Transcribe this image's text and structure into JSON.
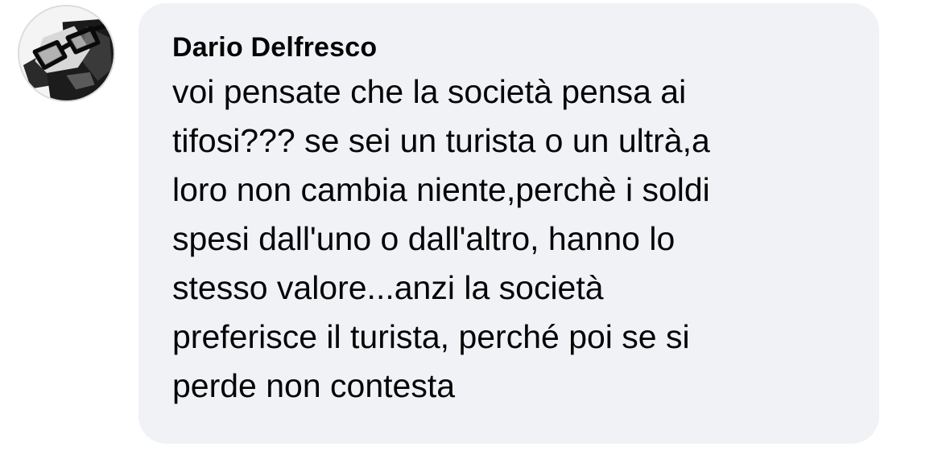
{
  "comment": {
    "avatar_icon": "user-photo-avatar",
    "author": "Dario Delfresco",
    "lines": [
      "voi pensate che la società pensa ai",
      "tifosi??? se sei un turista o un ultrà,a",
      "loro non cambia niente,perchè i soldi",
      "spesi dall'uno o dall'altro, hanno lo",
      "stesso valore...anzi la società",
      "preferisce il turista, perché poi se si",
      "perde non contesta"
    ]
  },
  "colors": {
    "bubble_background": "#f0f2f5",
    "text": "#050505",
    "page_background": "#ffffff"
  }
}
